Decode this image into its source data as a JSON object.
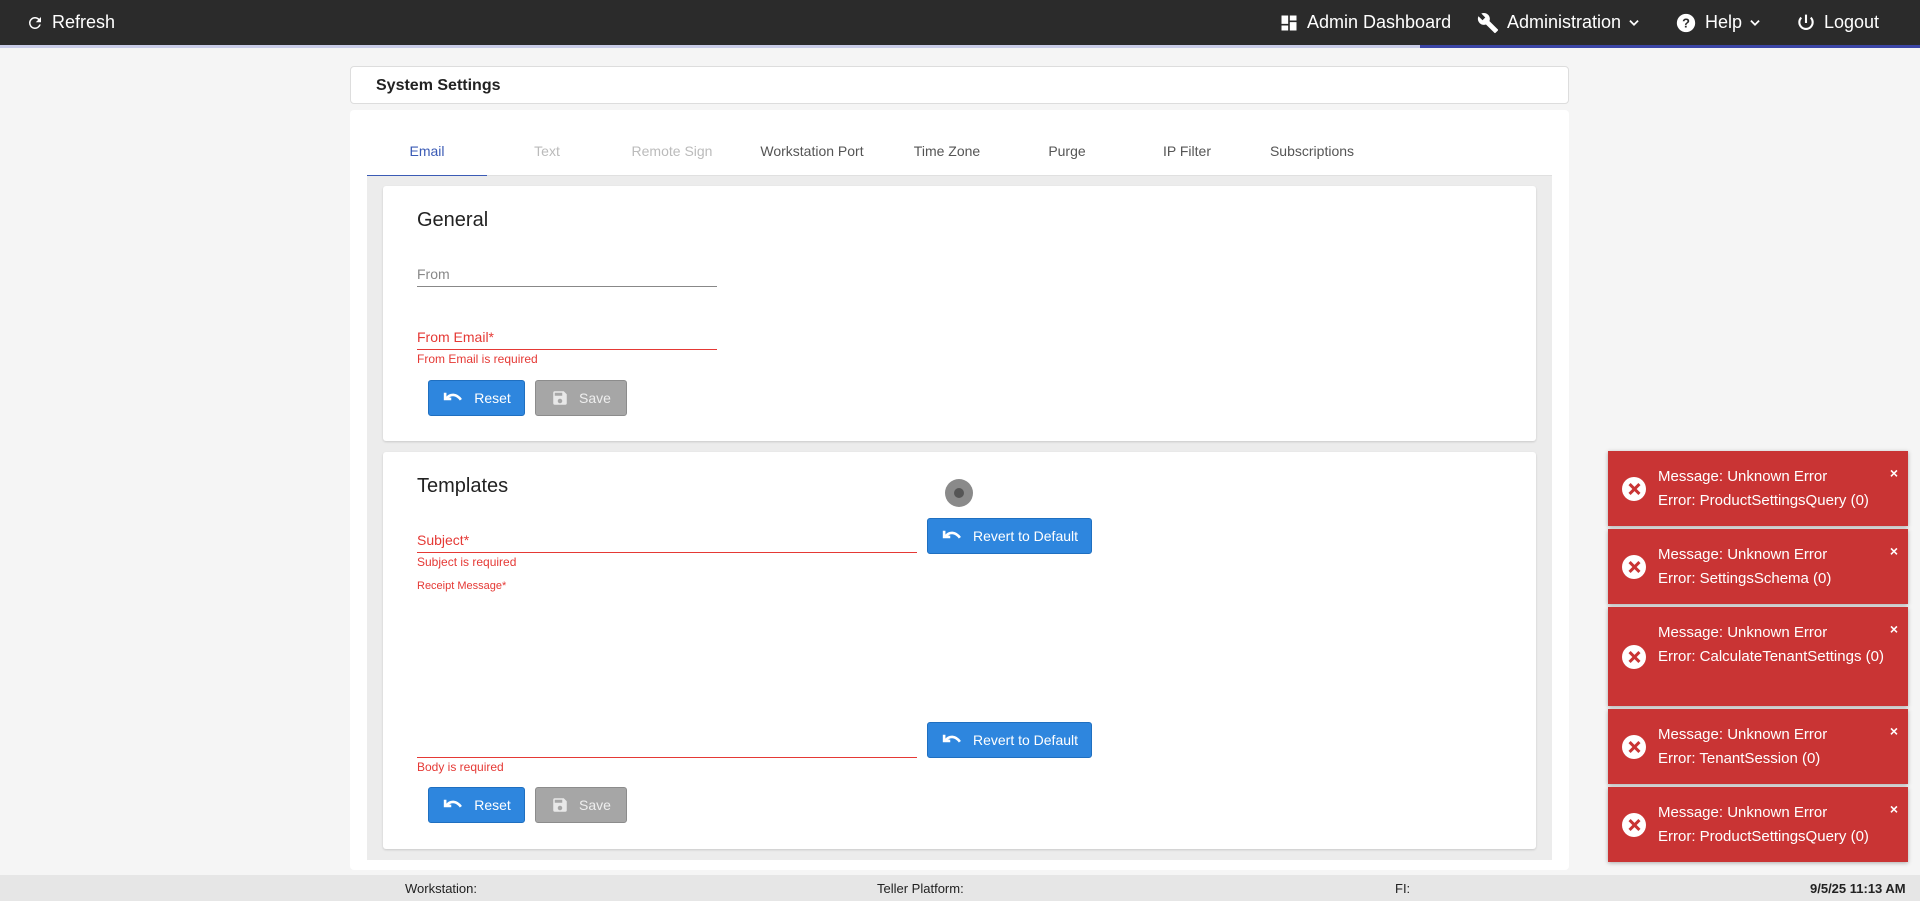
{
  "topbar": {
    "refresh_label": "Refresh",
    "admin_dashboard_label": "Admin Dashboard",
    "administration_label": "Administration",
    "help_label": "Help",
    "logout_label": "Logout"
  },
  "page_title": "System Settings",
  "tabs": [
    {
      "label": "Email",
      "state": "active"
    },
    {
      "label": "Text",
      "state": "disabled"
    },
    {
      "label": "Remote Sign",
      "state": "disabled"
    },
    {
      "label": "Workstation Port",
      "state": "normal"
    },
    {
      "label": "Time Zone",
      "state": "normal"
    },
    {
      "label": "Purge",
      "state": "normal"
    },
    {
      "label": "IP Filter",
      "state": "normal"
    },
    {
      "label": "Subscriptions",
      "state": "normal"
    }
  ],
  "general": {
    "title": "General",
    "from_label": "From",
    "from_email_label": "From Email*",
    "from_email_error": "From Email is required",
    "reset_label": "Reset",
    "save_label": "Save"
  },
  "templates": {
    "title": "Templates",
    "subject_label": "Subject*",
    "subject_error": "Subject is required",
    "receipt_label": "Receipt Message*",
    "body_error": "Body is required",
    "revert_label": "Revert to Default",
    "reset_label": "Reset",
    "save_label": "Save"
  },
  "toasts": [
    {
      "line1": "Message: Unknown Error",
      "line2": "Error: ProductSettingsQuery (0)"
    },
    {
      "line1": "Message: Unknown Error",
      "line2": "Error: SettingsSchema (0)"
    },
    {
      "line1": "Message: Unknown Error",
      "line2": "Error: CalculateTenantSettings (0)"
    },
    {
      "line1": "Message: Unknown Error",
      "line2": "Error: TenantSession (0)"
    },
    {
      "line1": "Message: Unknown Error",
      "line2": "Error: ProductSettingsQuery (0)"
    }
  ],
  "toast_close": "×",
  "footer": {
    "workstation": "Workstation:",
    "teller_platform": "Teller Platform:",
    "fi": "FI:",
    "datetime": "9/5/25 11:13 AM"
  },
  "colors": {
    "topbar": "#2b2b2b",
    "accent": "#3b45a6",
    "primary_button": "#2e86de",
    "error": "#e53935",
    "toast": "#c93434"
  }
}
